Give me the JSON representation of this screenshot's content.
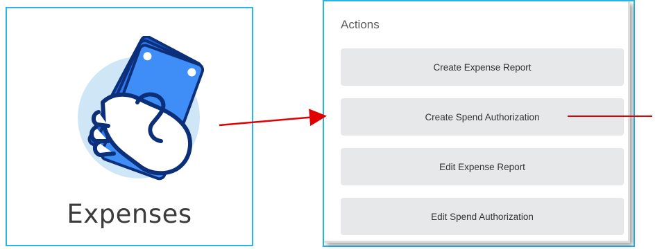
{
  "tile": {
    "label": "Expenses",
    "icon": "cash-in-hand-icon"
  },
  "actions": {
    "title": "Actions",
    "buttons": [
      {
        "label": "Create Expense Report"
      },
      {
        "label": "Create Spend Authorization"
      },
      {
        "label": "Edit Expense Report"
      },
      {
        "label": "Edit Spend Authorization"
      }
    ]
  },
  "annotations": {
    "arrow_color": "#e00000",
    "frame_color": "#29b6e6"
  }
}
